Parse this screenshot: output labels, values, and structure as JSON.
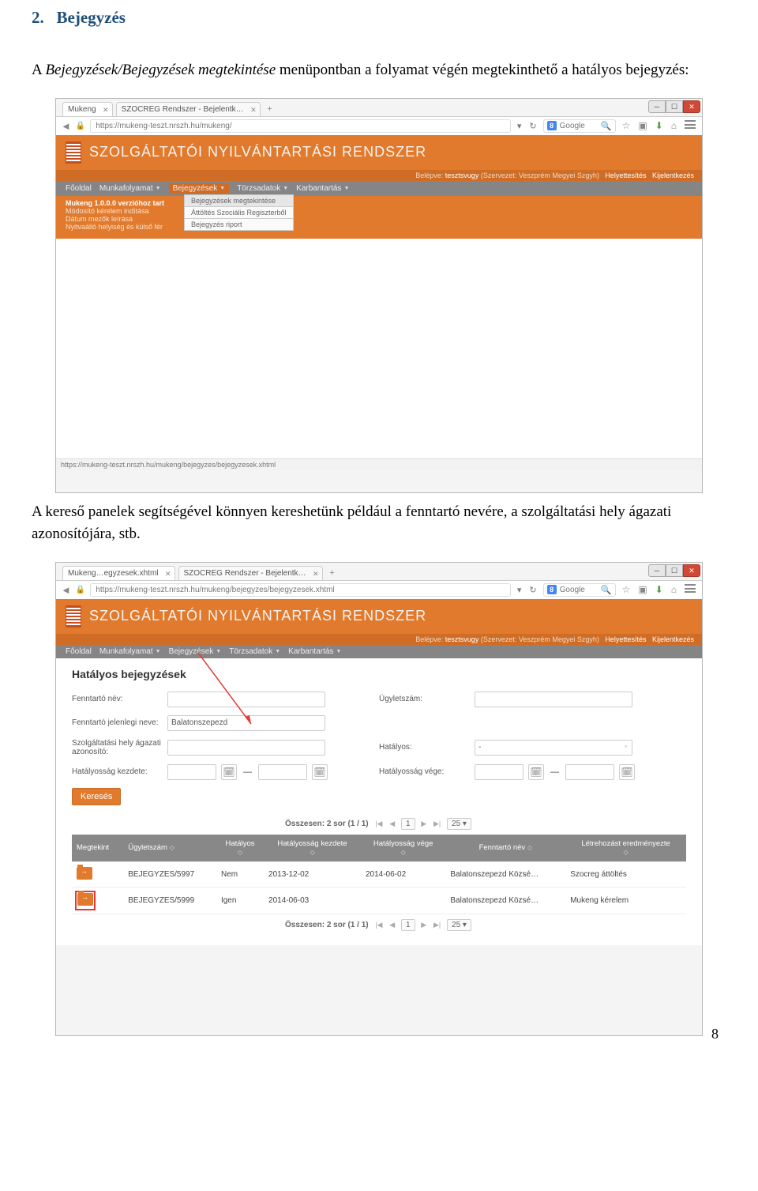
{
  "doc": {
    "heading_num": "2.",
    "heading_title": "Bejegyzés",
    "para1_a": "A ",
    "para1_b": "Bejegyzések/Bejegyzések megtekintése",
    "para1_c": " menüpontban a folyamat végén megtekinthető a hatályos bejegyzés:",
    "para2": "A kereső panelek segítségével könnyen kereshetünk például a fenntartó nevére, a szolgáltatási hely ágazati azonosítójára, stb.",
    "page_number": "8"
  },
  "browser1": {
    "tab1_label": "Mukeng",
    "tab2_label": "SZOCREG Rendszer - Bejelentk…",
    "addr": "https://mukeng-teszt.nrszh.hu/mukeng/",
    "google_label": "Google",
    "status_url": "https://mukeng-teszt.nrszh.hu/mukeng/bejegyzes/bejegyzesek.xhtml",
    "app_title": "SZOLGÁLTATÓI NYILVÁNTARTÁSI RENDSZER",
    "login_belepve": "Belépve:",
    "login_user": "tesztsvugy",
    "login_org": "(Szervezet: Veszprém Megyei Szgyh)",
    "login_helyett": "Helyettesítés",
    "login_kijel": "Kijelentkezés",
    "menu_f": "Főoldal",
    "menu_m": "Munkafolyamat",
    "menu_be": "Bejegyzések",
    "menu_t": "Törzsadatok",
    "menu_k": "Karbantartás",
    "note1": "Mukeng 1.0.0.0 verzióhoz tart",
    "note2": "Módosító kérelem indítása",
    "note3": "Dátum mezők leírása",
    "note4": "Nyitvaálló helyiség és külső fér",
    "drop1": "Bejegyzések megtekintése",
    "drop2": "Áttöltés Szociális Regiszterből",
    "drop3": "Bejegyzés riport"
  },
  "browser2": {
    "tab1_label": "Mukeng…egyzesek.xhtml",
    "tab2_label": "SZOCREG Rendszer - Bejelentk…",
    "addr": "https://mukeng-teszt.nrszh.hu/mukeng/bejegyzes/bejegyzesek.xhtml",
    "app_title": "SZOLGÁLTATÓI NYILVÁNTARTÁSI RENDSZER",
    "login_belepve": "Belépve:",
    "login_user": "tesztsvugy",
    "login_org": "(Szervezet: Veszprém Megyei Szgyh)",
    "login_helyett": "Helyettesítés",
    "login_kijel": "Kijelentkezés",
    "menu_f": "Főoldal",
    "menu_m": "Munkafolyamat",
    "menu_be": "Bejegyzések",
    "menu_t": "Törzsadatok",
    "menu_k": "Karbantartás",
    "form_title": "Hatályos bejegyzések",
    "lbl_fenntarto_nev": "Fenntartó név:",
    "lbl_ugyletszam": "Ügyletszám:",
    "lbl_fenntarto_jelen": "Fenntartó jelenlegi neve:",
    "val_fenntarto_jelen": "Balatonszepezd",
    "lbl_szolg_agazati": "Szolgáltatási hely ágazati azonosító:",
    "lbl_hatalyos": "Hatályos:",
    "val_hatalyos": "-",
    "lbl_hatalyossag_kezdete": "Hatályosság kezdete:",
    "lbl_hatalyossag_vege": "Hatályosság vége:",
    "btn_kereses": "Keresés",
    "pager_total": "Összesen: 2 sor (1 / 1)",
    "pager_current": "1",
    "pager_pagesize": "25",
    "pager2_total": "Összesen: 2 sor (1 / 1)",
    "pager2_pagesize": "25",
    "th_megtekint": "Megtekint",
    "th_ugyletszam": "Ügyletszám",
    "th_hatalyos": "Hatályos",
    "th_hat_kezdete": "Hatályosság kezdete",
    "th_hat_vege": "Hatályosság vége",
    "th_fenntarto": "Fenntartó név",
    "th_letrehozast": "Létrehozást eredményezte",
    "rows": [
      {
        "ugylet": "BEJEGYZES/5997",
        "hatalyos": "Nem",
        "kezd": "2013-12-02",
        "vege": "2014-06-02",
        "fenn": "Balatonszepezd Közsé…",
        "letre": "Szocreg áttöltés"
      },
      {
        "ugylet": "BEJEGYZES/5999",
        "hatalyos": "Igen",
        "kezd": "2014-06-03",
        "vege": "",
        "fenn": "Balatonszepezd Közsé…",
        "letre": "Mukeng kérelem"
      }
    ]
  }
}
